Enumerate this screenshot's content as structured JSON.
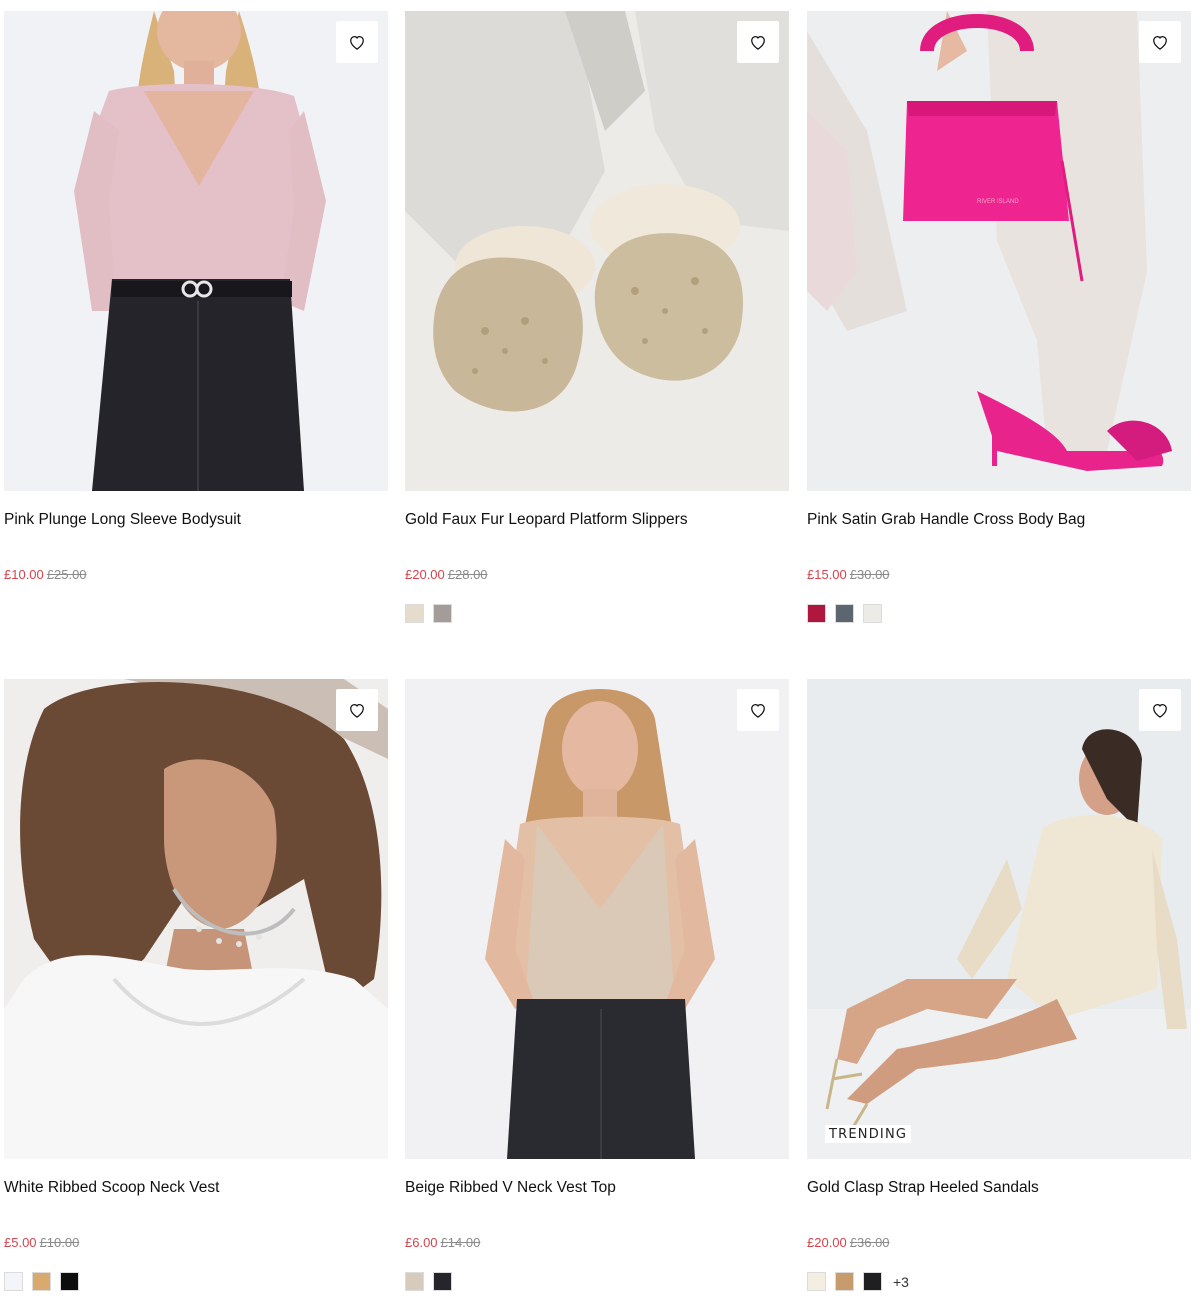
{
  "products": [
    {
      "title": "Pink Plunge Long Sleeve Bodysuit",
      "price_now": "£10.00",
      "price_was": "£25.00",
      "swatches": [],
      "badge": "",
      "more": "",
      "bag_text": ""
    },
    {
      "title": "Gold Faux Fur Leopard Platform Slippers",
      "price_now": "£20.00",
      "price_was": "£28.00",
      "swatches": [
        "#e6dccd",
        "#a39c98"
      ],
      "badge": "",
      "more": "",
      "bag_text": ""
    },
    {
      "title": "Pink Satin Grab Handle Cross Body Bag",
      "price_now": "£15.00",
      "price_was": "£30.00",
      "swatches": [
        "#b0173f",
        "#5c6670",
        "#ecebe6"
      ],
      "badge": "",
      "more": "",
      "bag_text": "RIVER ISLAND"
    },
    {
      "title": "White Ribbed Scoop Neck Vest",
      "price_now": "£5.00",
      "price_was": "£10.00",
      "swatches": [
        "#f4f4fb",
        "#d8aa6e",
        "#0d0d0d"
      ],
      "badge": "",
      "more": "",
      "bag_text": ""
    },
    {
      "title": "Beige Ribbed V Neck Vest Top",
      "price_now": "£6.00",
      "price_was": "£14.00",
      "swatches": [
        "#d7cbbd",
        "#25252b"
      ],
      "badge": "",
      "more": "",
      "bag_text": ""
    },
    {
      "title": "Gold Clasp Strap Heeled Sandals",
      "price_now": "£20.00",
      "price_was": "£36.00",
      "swatches": [
        "#f3eee1",
        "#c79b6c",
        "#1f1f22"
      ],
      "badge": "TRENDING",
      "more": "+3",
      "bag_text": ""
    }
  ],
  "icons": {
    "wishlist": "heart-outline-icon"
  },
  "colors": {
    "sale_price": "#d6434c",
    "was_price": "#8a8a8a"
  }
}
